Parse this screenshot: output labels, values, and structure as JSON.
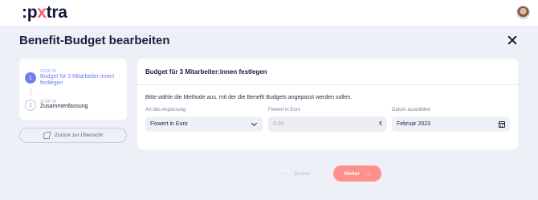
{
  "header": {
    "logo_prefix": ":p",
    "logo_x": "x",
    "logo_suffix": "tra"
  },
  "page": {
    "title": "Benefit-Budget bearbeiten"
  },
  "steps": [
    {
      "meta": "STEP 01",
      "title": "Budget für 3 Mitarbeiter:innen festlegen",
      "number": "1",
      "state": "active"
    },
    {
      "meta": "STEP 02",
      "title": "Zusammenfassung",
      "number": "2",
      "state": "inactive"
    }
  ],
  "sidebar": {
    "back_label": "Zurück zur Übersicht"
  },
  "form": {
    "title": "Budget für 3 Mitarbeiter:innen festlegen",
    "description": "Bitte wähle die Methode aus, mit der die Benefit Budgets angepasst werden sollen.",
    "fields": {
      "method": {
        "label": "Art des Anpassung",
        "value": "Fixwert in Euro"
      },
      "fixed": {
        "label": "Fixwert in Euro",
        "placeholder": "0.00",
        "unit": "€"
      },
      "date": {
        "label": "Datum auswählen",
        "value": "Februar 2023"
      }
    }
  },
  "footer": {
    "back_label": "Zurück",
    "next_label": "Weiter",
    "back_arrow": "←",
    "next_arrow": "→"
  },
  "colors": {
    "accent": "#6f7cf0",
    "primary_button": "#fe8f8a",
    "background": "#eef0f7"
  }
}
